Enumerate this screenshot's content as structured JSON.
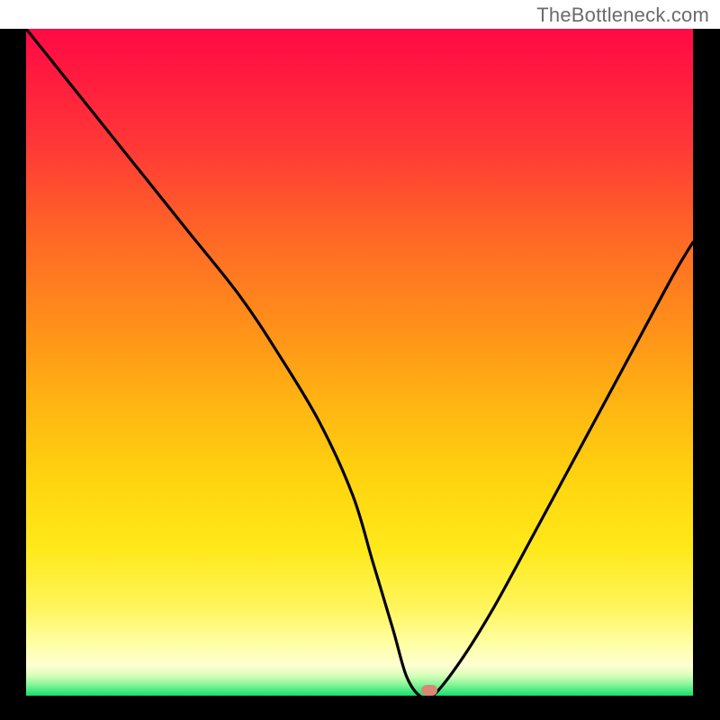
{
  "watermark": "TheBottleneck.com",
  "chart_data": {
    "type": "line",
    "title": "",
    "xlabel": "",
    "ylabel": "",
    "xlim": [
      0,
      100
    ],
    "ylim": [
      0,
      100
    ],
    "background": "rainbow-gradient-vertical",
    "series": [
      {
        "name": "bottleneck-curve",
        "x": [
          0,
          8,
          16,
          24,
          32,
          38,
          44,
          49,
          52,
          55,
          57,
          59,
          61,
          65,
          70,
          76,
          83,
          90,
          97,
          100
        ],
        "values": [
          100,
          90,
          80,
          70,
          60,
          51,
          41,
          30,
          20,
          10,
          3,
          0,
          0,
          5,
          13,
          24,
          37,
          50,
          63,
          68
        ]
      }
    ],
    "marker": {
      "x": 60.5,
      "y": 0.8,
      "color": "#d98876"
    },
    "frame_color": "#000000"
  }
}
